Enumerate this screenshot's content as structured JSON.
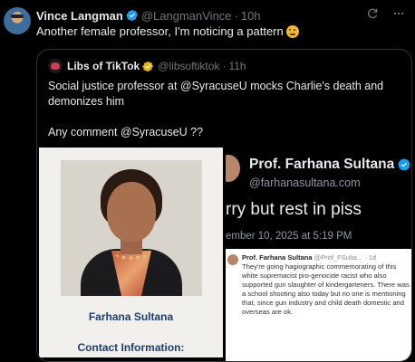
{
  "tweet": {
    "author_name": "Vince Langman",
    "author_handle": "@LangmanVince",
    "separator": "·",
    "time": "10h",
    "text": "Another female professor,  I'm noticing a pattern"
  },
  "quote": {
    "author_name": "Libs of TikTok",
    "author_handle": "@libsoftiktok",
    "separator": "·",
    "time": "11h",
    "body_line1": "Social justice professor at @SyracuseU mocks Charlie's death and demonizes him",
    "body_line2": "Any comment @SyracuseU ??"
  },
  "media_left": {
    "person_name": "Farhana Sultana",
    "contact_label": "Contact Information:"
  },
  "media_right": {
    "name": "Prof. Farhana Sultana",
    "handle": "@farhanasultana.com",
    "post_text": "rry but rest in piss",
    "post_date": "ember 10, 2025 at 5:19 PM",
    "inner_name": "Prof. Farhana Sultana",
    "inner_handle": "@Prof_FSulta... · 1d",
    "inner_body": "They're going hagiographic commemorating of this white supremacist pro-genocide racist who also supported gun slaughter of kindergarteners. There was a school shooting also today but no one is mentioning that, since gun industry and child death domestic and overseas are ok."
  },
  "colors": {
    "background": "#000000",
    "text_primary": "#e7e9ea",
    "text_secondary": "#71767b",
    "verified_blue": "#1d9bf0",
    "verified_gold": "#e2b719",
    "border": "#2f3336"
  },
  "icons": {
    "verified": "verified-badge-icon",
    "grok": "grok-icon",
    "more": "more-options-icon",
    "emoji": "thinking-face-emoji"
  }
}
